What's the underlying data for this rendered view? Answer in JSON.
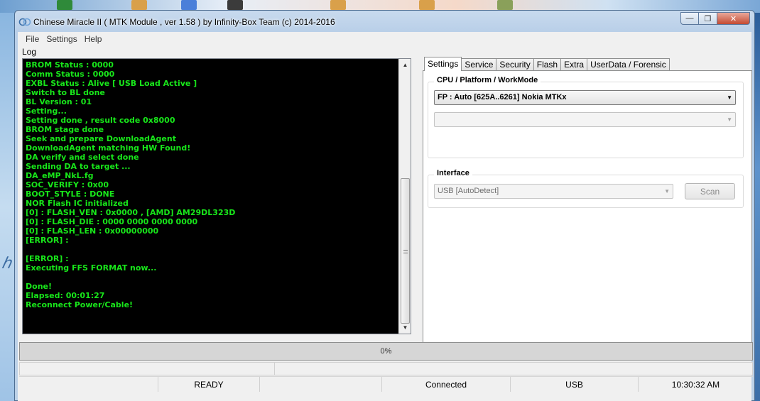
{
  "window": {
    "title": "Chinese Miracle II ( MTK Module , ver 1.58 ) by Infinity-Box Team (c) 2014-2016",
    "controls": {
      "minimize": "—",
      "maximize": "❐",
      "close": "✕"
    }
  },
  "menu": [
    {
      "label": "File"
    },
    {
      "label": "Settings"
    },
    {
      "label": "Help"
    }
  ],
  "log": {
    "label": "Log",
    "lines": [
      "BROM Status : 0000",
      "Comm Status : 0000",
      "EXBL Status : Alive [ USB Load Active ]",
      "Switch to BL done",
      "BL Version : 01",
      "Setting...",
      "Setting done , result code 0x8000",
      "BROM stage done",
      "Seek and prepare DownloadAgent",
      "DownloadAgent matching HW Found!",
      "DA verify and select done",
      "Sending DA to target ...",
      "DA_eMP_NkL.fg",
      "SOC_VERIFY : 0x00",
      "BOOT_STYLE : DONE",
      "NOR Flash IC initialized",
      "[0] : FLASH_VEN : 0x0000 , [AMD] AM29DL323D",
      "[0] : FLASH_DIE : 0000 0000 0000 0000",
      "[0] : FLASH_LEN : 0x00000000",
      "[ERROR] :",
      "",
      "[ERROR] :",
      "Executing FFS FORMAT now...",
      "",
      "Done!",
      "Elapsed: 00:01:27",
      "Reconnect Power/Cable!"
    ],
    "text_color": "#18e61a",
    "background": "#000000"
  },
  "tabs": [
    {
      "label": "Settings",
      "active": true
    },
    {
      "label": "Service",
      "active": false
    },
    {
      "label": "Security",
      "active": false
    },
    {
      "label": "Flash",
      "active": false
    },
    {
      "label": "Extra",
      "active": false
    },
    {
      "label": "UserData / Forensic",
      "active": false
    }
  ],
  "settings": {
    "cpu_group_title": "CPU / Platform / WorkMode",
    "cpu_select_value": "FP : Auto [625A..6261] Nokia MTKx",
    "secondary_select_value": "",
    "interface_group_title": "Interface",
    "interface_select_value": "USB [AutoDetect]",
    "scan_button": "Scan"
  },
  "progress": {
    "value_percent": 0,
    "label": "0%",
    "fill_color": "#1f9d20"
  },
  "status": {
    "state": "READY",
    "connection": "Connected",
    "port": "USB",
    "time": "10:30:32 AM"
  }
}
